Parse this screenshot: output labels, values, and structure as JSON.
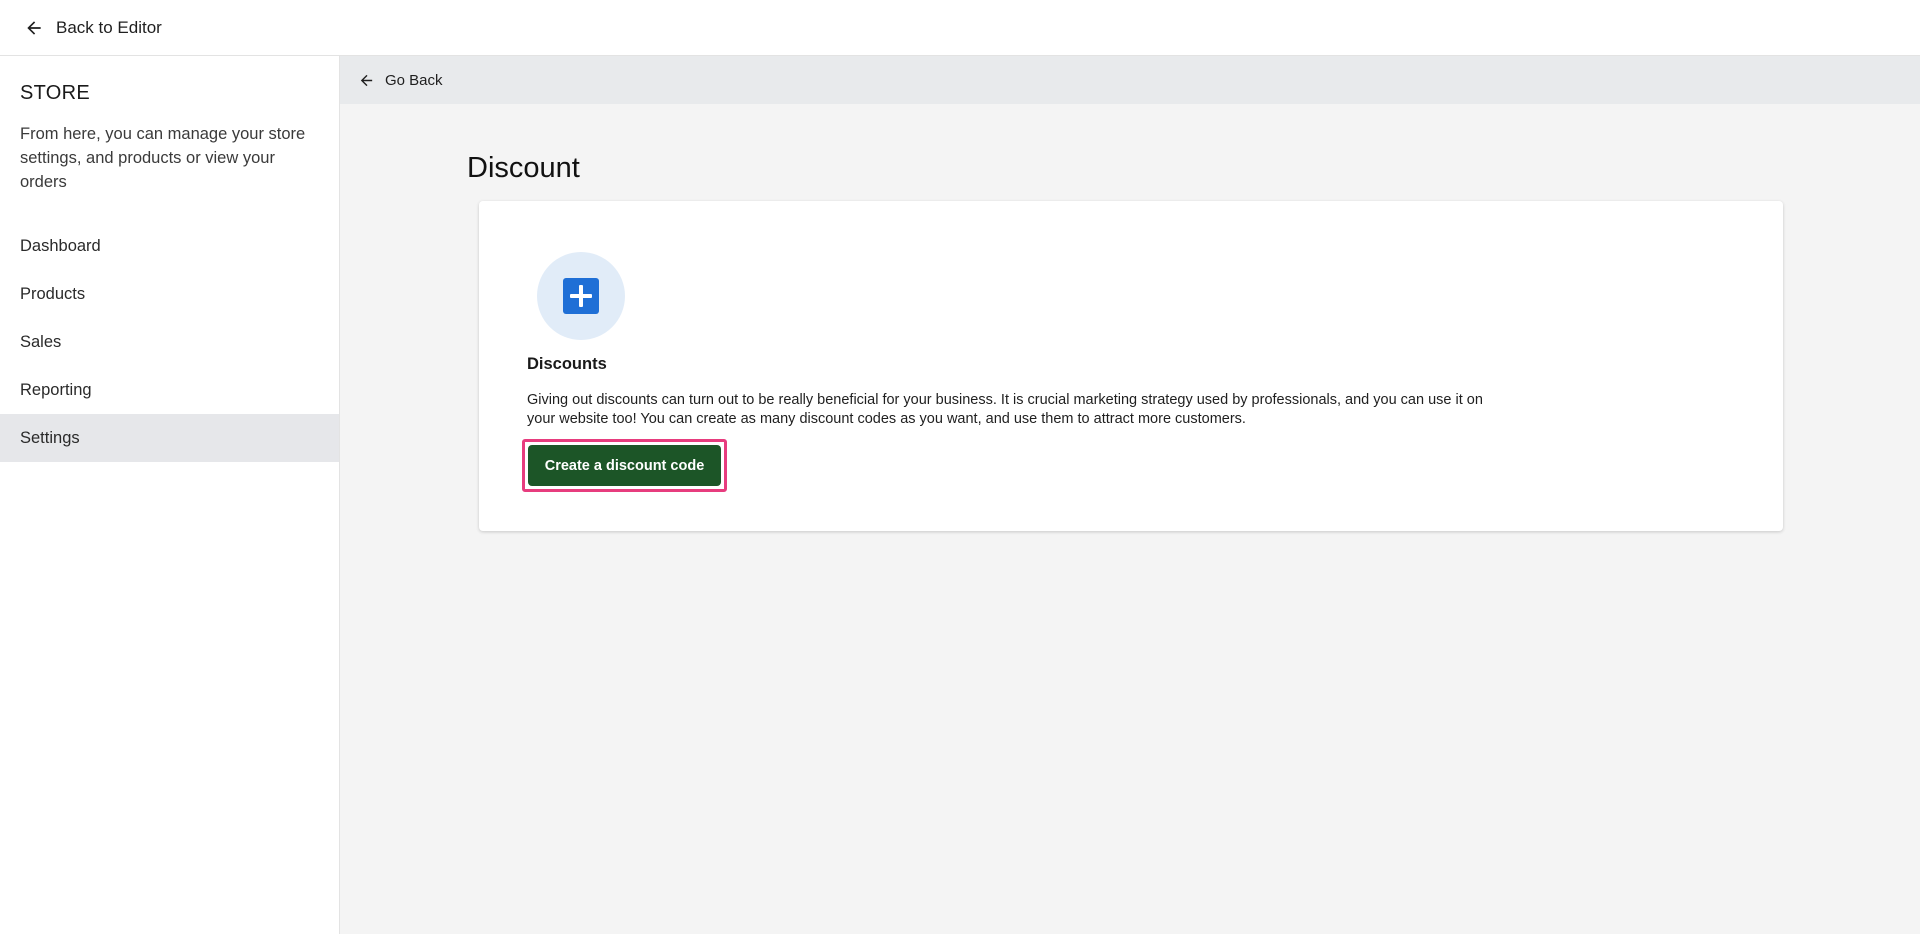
{
  "topbar": {
    "back_label": "Back to Editor",
    "back_icon": "arrow-left-icon"
  },
  "sidebar": {
    "title": "STORE",
    "description": "From here, you can manage your store settings, and products or view your orders",
    "items": [
      {
        "label": "Dashboard",
        "active": false
      },
      {
        "label": "Products",
        "active": false
      },
      {
        "label": "Sales",
        "active": false
      },
      {
        "label": "Reporting",
        "active": false
      },
      {
        "label": "Settings",
        "active": true
      }
    ]
  },
  "main": {
    "go_back_label": "Go Back",
    "page_title": "Discount",
    "card": {
      "icon": "plus-icon",
      "heading": "Discounts",
      "text": "Giving out discounts can turn out to be really beneficial for your business. It is crucial marketing strategy used by professionals, and you can use it on your website too! You can create as many discount codes as you want, and use them to attract more customers.",
      "button_label": "Create a discount code"
    }
  },
  "colors": {
    "primary_button": "#1c5527",
    "highlight_border": "#e73c7e",
    "icon_blue": "#1f6fd6",
    "icon_circle_bg": "#e1ecf8",
    "active_nav_bg": "#e6e7ea"
  }
}
